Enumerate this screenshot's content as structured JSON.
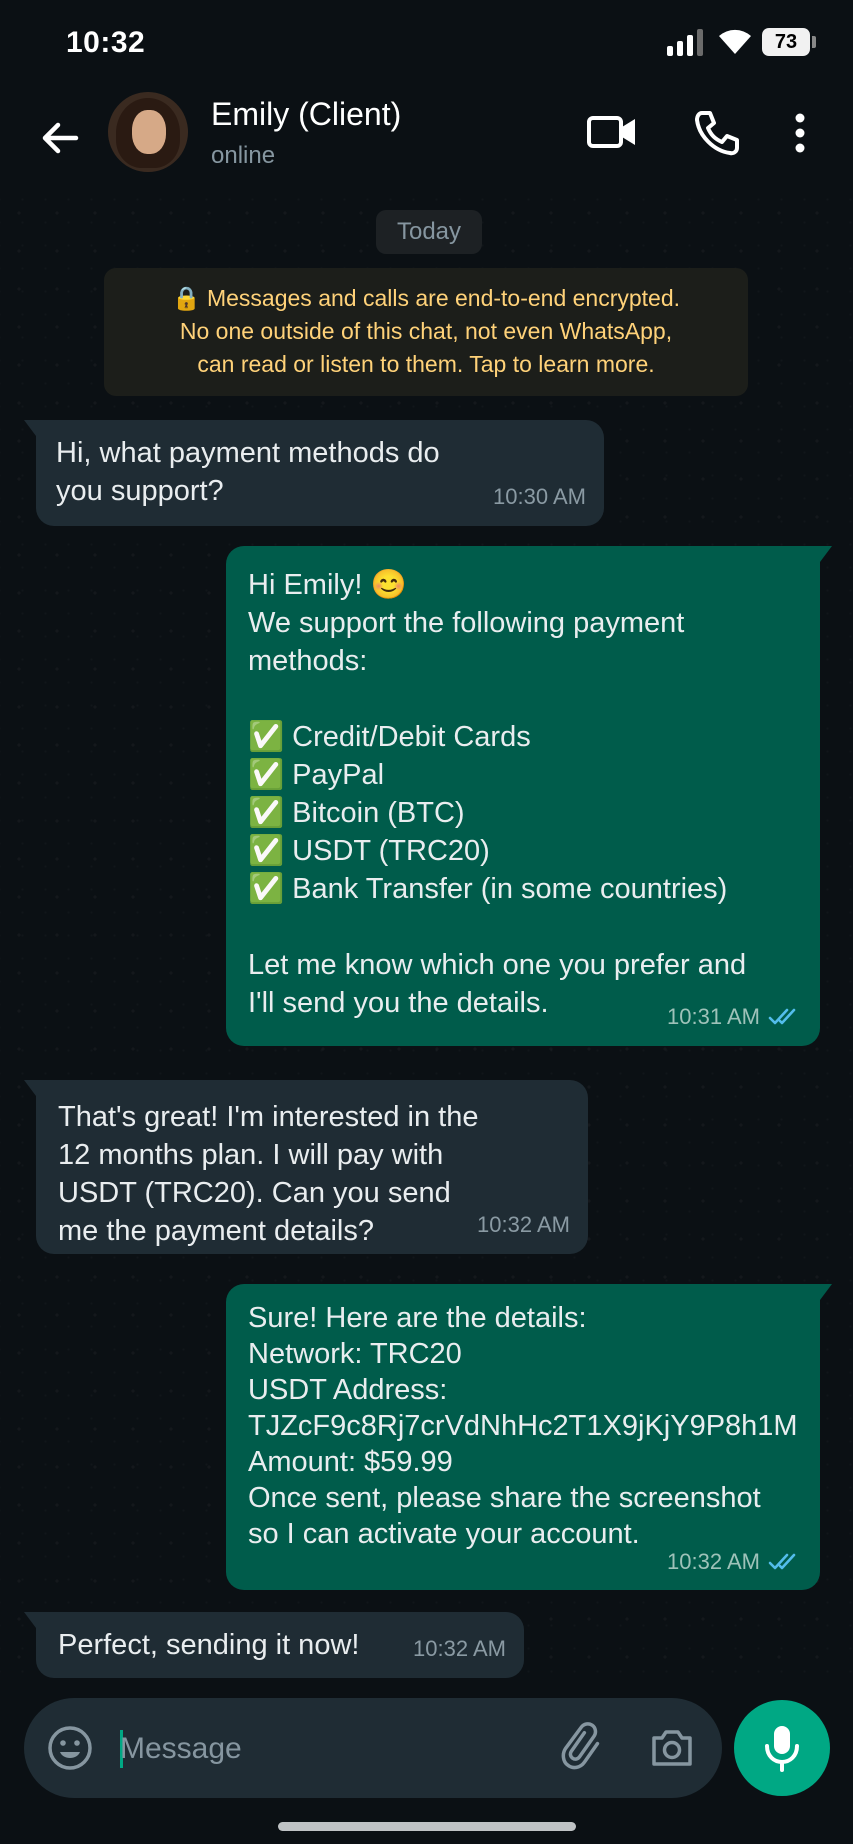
{
  "status_bar": {
    "time": "10:32",
    "battery": "73"
  },
  "header": {
    "contact_name": "Emily (Client)",
    "contact_status": "online",
    "icons": [
      "back-arrow-icon",
      "video-call-icon",
      "phone-icon",
      "more-vert-icon"
    ]
  },
  "chat": {
    "date_label": "Today",
    "encryption_notice": "🔒 Messages and calls are end-to-end encrypted.\nNo one outside of this chat, not even WhatsApp,\ncan read or listen to them. Tap to learn more.",
    "messages": [
      {
        "direction": "incoming",
        "text": "Hi, what payment methods do\nyou support?",
        "time": "10:30 AM"
      },
      {
        "direction": "outgoing",
        "text": "Hi Emily! 😊\nWe support the following payment\nmethods:\n\n✅ Credit/Debit Cards\n✅ PayPal\n✅ Bitcoin (BTC)\n✅ USDT (TRC20)\n✅ Bank Transfer (in some countries)\n\nLet me know which one you prefer and\nI'll send you the details.",
        "time": "10:31 AM",
        "read": true
      },
      {
        "direction": "incoming",
        "text": "That's great! I'm interested in the\n12 months plan. I will pay with\nUSDT (TRC20). Can you send\nme the payment details?",
        "time": "10:32 AM"
      },
      {
        "direction": "outgoing",
        "text": "Sure! Here are the details:\nNetwork: TRC20\nUSDT Address:\nTJZcF9c8Rj7crVdNhHc2T1X9jKjY9P8h1M\nAmount: $59.99\nOnce sent, please share the screenshot\nso I can activate your account.",
        "time": "10:32 AM",
        "read": true
      },
      {
        "direction": "incoming",
        "text": "Perfect, sending it now!",
        "time": "10:32 AM"
      }
    ]
  },
  "composer": {
    "placeholder": "Message",
    "icons": [
      "emoji-icon",
      "attach-icon",
      "camera-icon",
      "mic-icon"
    ]
  },
  "colors": {
    "background": "#0b1014",
    "incoming_bubble": "#1f2c34",
    "outgoing_bubble": "#005c4b",
    "accent": "#00a884",
    "read_check": "#53bdeb",
    "encryption_text": "#ffd279"
  }
}
